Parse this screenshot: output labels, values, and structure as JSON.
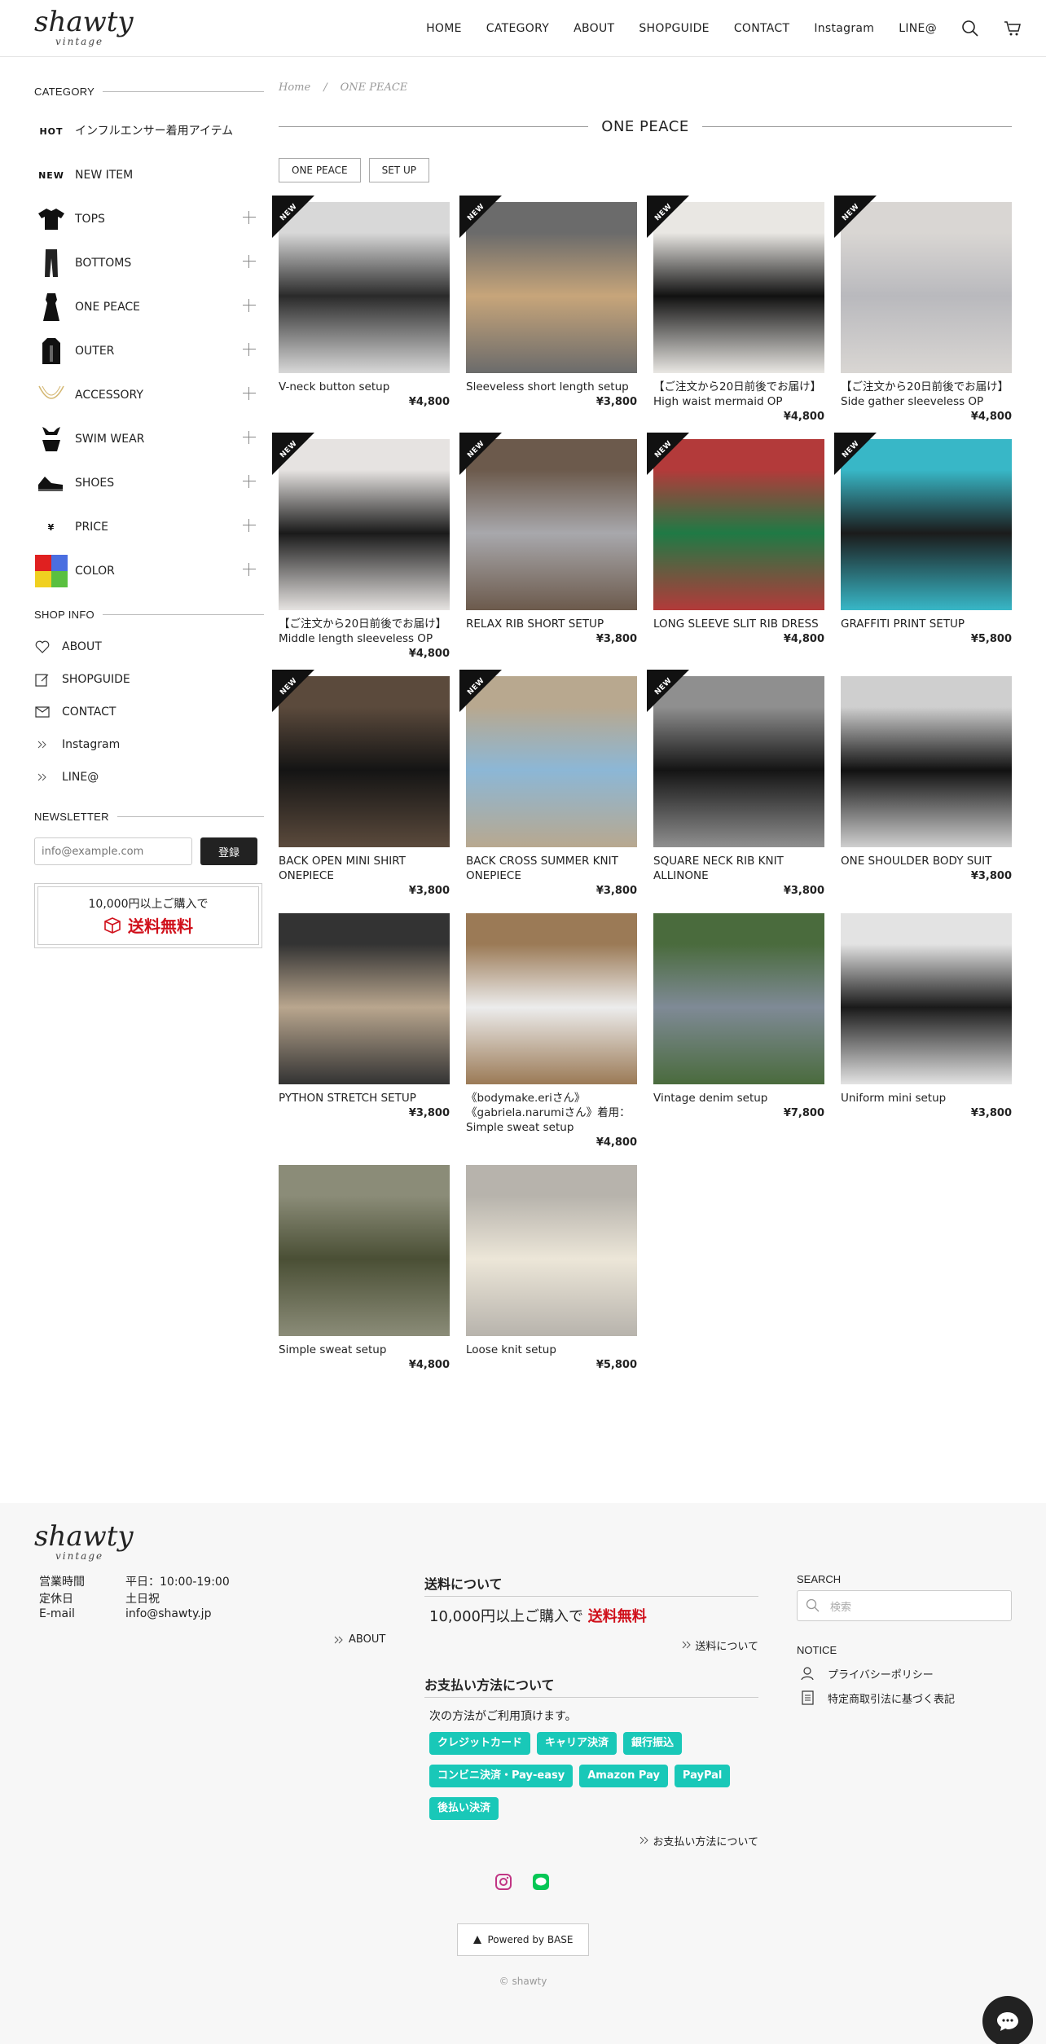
{
  "header": {
    "logo_main": "shawty",
    "logo_sub": "vintage",
    "nav": [
      "HOME",
      "CATEGORY",
      "ABOUT",
      "SHOPGUIDE",
      "CONTACT",
      "Instagram",
      "LINE@"
    ]
  },
  "sidebar": {
    "category_heading": "CATEGORY",
    "categories": [
      {
        "badge": "HOT",
        "label": "インフルエンサー着用アイテム",
        "expandable": false
      },
      {
        "badge": "NEW",
        "label": "NEW ITEM",
        "expandable": false
      },
      {
        "icon": "top-icon",
        "label": "TOPS",
        "expandable": true
      },
      {
        "icon": "pants-icon",
        "label": "BOTTOMS",
        "expandable": true
      },
      {
        "icon": "dress-icon",
        "label": "ONE PEACE",
        "expandable": true
      },
      {
        "icon": "jacket-icon",
        "label": "OUTER",
        "expandable": true
      },
      {
        "icon": "necklace-icon",
        "label": "ACCESSORY",
        "expandable": true
      },
      {
        "icon": "swimwear-icon",
        "label": "SWIM WEAR",
        "expandable": true
      },
      {
        "icon": "shoe-icon",
        "label": "SHOES",
        "expandable": true
      },
      {
        "badge": "¥",
        "label": "PRICE",
        "expandable": true
      },
      {
        "icon": "color-swatch-icon",
        "label": "COLOR",
        "expandable": true
      }
    ],
    "shopinfo_heading": "SHOP INFO",
    "shopinfo": [
      {
        "icon": "heart-icon",
        "label": "ABOUT"
      },
      {
        "icon": "edit-icon",
        "label": "SHOPGUIDE"
      },
      {
        "icon": "mail-icon",
        "label": "CONTACT"
      },
      {
        "icon": "double-chevron-icon",
        "label": "Instagram"
      },
      {
        "icon": "double-chevron-icon",
        "label": "LINE@"
      }
    ],
    "newsletter_heading": "NEWSLETTER",
    "newsletter_placeholder": "info@example.com",
    "newsletter_button": "登録",
    "freeship_top": "10,000円以上ご購入で",
    "freeship_bottom": "送料無料"
  },
  "main": {
    "breadcrumb": [
      "Home",
      "ONE PEACE"
    ],
    "title": "ONE PEACE",
    "tags": [
      "ONE PEACE",
      "SET UP"
    ],
    "products": [
      {
        "name": "V-neck button setup",
        "price": "¥4,800",
        "new": true,
        "colors": [
          "#2a2a2a",
          "#d8d8d8"
        ]
      },
      {
        "name": "Sleeveless short length setup",
        "price": "¥3,800",
        "new": true,
        "colors": [
          "#c7a57a",
          "#6b6b6b"
        ]
      },
      {
        "name": "【ご注文から20日前後でお届け】High waist mermaid OP",
        "price": "¥4,800",
        "new": true,
        "colors": [
          "#111111",
          "#e9e7e3"
        ]
      },
      {
        "name": "【ご注文から20日前後でお届け】Side gather sleeveless OP",
        "price": "¥4,800",
        "new": true,
        "colors": [
          "#b9b9bd",
          "#d9d6d3"
        ]
      },
      {
        "name": "【ご注文から20日前後でお届け】Middle length sleeveless OP",
        "price": "¥4,800",
        "new": true,
        "colors": [
          "#1a1a1a",
          "#e6e3e1"
        ]
      },
      {
        "name": "RELAX RIB SHORT SETUP",
        "price": "¥3,800",
        "new": true,
        "colors": [
          "#a8a8ac",
          "#6c5a4c"
        ]
      },
      {
        "name": "LONG SLEEVE SLIT RIB DRESS",
        "price": "¥4,800",
        "new": true,
        "colors": [
          "#1f7a45",
          "#b33a3a"
        ]
      },
      {
        "name": "GRAFFITI PRINT SETUP",
        "price": "¥5,800",
        "new": true,
        "colors": [
          "#1b1b1b",
          "#38b7c7"
        ]
      },
      {
        "name": "BACK OPEN MINI SHIRT ONEPIECE",
        "price": "¥3,800",
        "new": true,
        "colors": [
          "#141414",
          "#5b4a3c"
        ]
      },
      {
        "name": "BACK CROSS SUMMER KNIT ONEPIECE",
        "price": "¥3,800",
        "new": true,
        "colors": [
          "#8cb7d6",
          "#b8a88f"
        ]
      },
      {
        "name": "SQUARE NECK RIB KNIT ALLINONE",
        "price": "¥3,800",
        "new": true,
        "colors": [
          "#141414",
          "#8f8f8f"
        ]
      },
      {
        "name": "ONE SHOULDER BODY SUIT",
        "price": "¥3,800",
        "new": false,
        "colors": [
          "#111111",
          "#cfcfcf"
        ]
      },
      {
        "name": "PYTHON STRETCH SETUP",
        "price": "¥3,800",
        "new": false,
        "colors": [
          "#b9a68e",
          "#333333"
        ]
      },
      {
        "name": "《bodymake.eriさん》《gabriela.narumiさん》着用：Simple sweat setup",
        "price": "¥4,800",
        "new": false,
        "colors": [
          "#ececec",
          "#9b7a56"
        ]
      },
      {
        "name": "Vintage denim setup",
        "price": "¥7,800",
        "new": false,
        "colors": [
          "#7f8a96",
          "#4a6b3d"
        ]
      },
      {
        "name": "Uniform mini setup",
        "price": "¥3,800",
        "new": false,
        "colors": [
          "#1a1a1a",
          "#e3e3e3"
        ]
      },
      {
        "name": "Simple sweat setup",
        "price": "¥4,800",
        "new": false,
        "colors": [
          "#4a4f35",
          "#8b8c78"
        ]
      },
      {
        "name": "Loose knit setup",
        "price": "¥5,800",
        "new": false,
        "colors": [
          "#ece6d8",
          "#b7b3ac"
        ]
      }
    ]
  },
  "footer": {
    "hours": [
      {
        "k": "営業時間",
        "v": "平日：10:00-19:00"
      },
      {
        "k": "定休日",
        "v": "土日祝"
      },
      {
        "k": "E-mail",
        "v": "info@shawty.jp"
      }
    ],
    "about_link": "ABOUT",
    "shipping_title": "送料について",
    "shipping_text": "10,000円以上ご購入で",
    "shipping_free": "送料無料",
    "shipping_link": "送料について",
    "payment_title": "お支払い方法について",
    "payment_desc": "次の方法がご利用頂けます。",
    "payments": [
      "クレジットカード",
      "キャリア決済",
      "銀行振込",
      "コンビニ決済・Pay-easy",
      "Amazon Pay",
      "PayPal",
      "後払い決済"
    ],
    "payment_link": "お支払い方法について",
    "search_heading": "SEARCH",
    "search_placeholder": "検索",
    "notice_heading": "NOTICE",
    "notices": [
      "プライバシーポリシー",
      "特定商取引法に基づく表記"
    ],
    "powered": "Powered by BASE",
    "copyright": "© shawty"
  }
}
